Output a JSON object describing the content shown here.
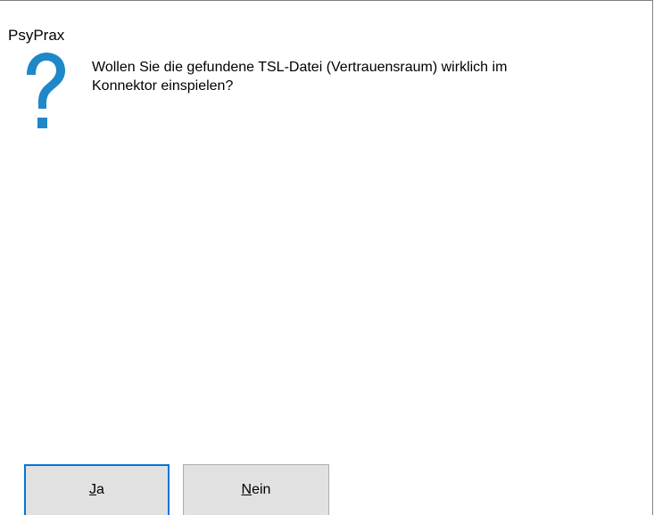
{
  "dialog": {
    "title": "PsyPrax",
    "icon": "question-icon",
    "message_line1": "Wollen Sie die gefundene TSL-Datei (Vertrauensraum) wirklich im",
    "message_line2": "Konnektor einspielen?",
    "accent_color": "#0078d7",
    "icon_color": "#1e88c8"
  },
  "buttons": {
    "yes_mnemonic": "J",
    "yes_rest": "a",
    "no_mnemonic": "N",
    "no_rest": "ein"
  }
}
